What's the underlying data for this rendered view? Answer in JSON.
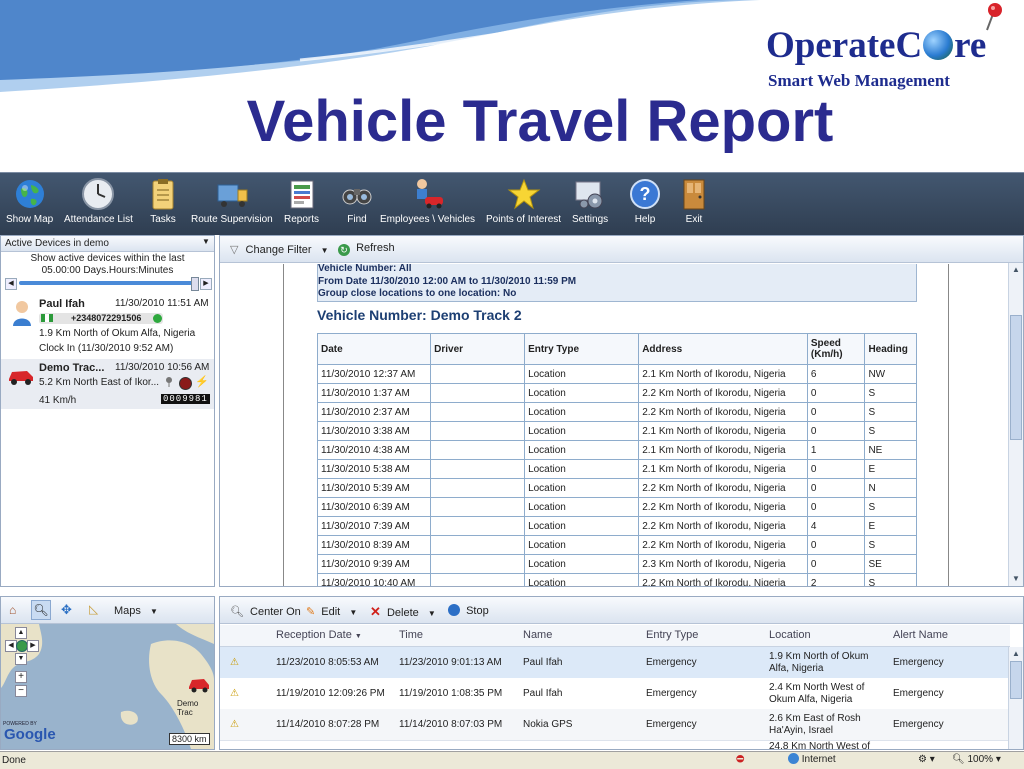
{
  "slide": {
    "title": "Vehicle Travel Report",
    "logo_left": "OperateC",
    "logo_right": "re",
    "logo_tagline": "Smart Web Management"
  },
  "toolbar": [
    {
      "label": "Show Map",
      "icon": "globe-icon"
    },
    {
      "label": "Attendance List",
      "icon": "clock-icon"
    },
    {
      "label": "Tasks",
      "icon": "clipboard-icon"
    },
    {
      "label": "Route Supervision",
      "icon": "truck-icon"
    },
    {
      "label": "Reports",
      "icon": "report-icon"
    },
    {
      "label": "Find",
      "icon": "binoculars-icon"
    },
    {
      "label": "Employees \\ Vehicles",
      "icon": "person-car-icon"
    },
    {
      "label": "Points of Interest",
      "icon": "star-icon"
    },
    {
      "label": "Settings",
      "icon": "gears-icon"
    },
    {
      "label": "Help",
      "icon": "help-icon"
    },
    {
      "label": "Exit",
      "icon": "door-icon"
    }
  ],
  "left_panel": {
    "filter_select": "Active Devices in demo",
    "filter_text_1": "Show active devices within the last",
    "filter_text_2": "05.00:00 Days.Hours:Minutes",
    "devices": [
      {
        "name": "Paul Ifah",
        "time": "11/30/2010 11:51 AM",
        "phone": "+2348072291506",
        "location": "1.9 Km North of Okum Alfa, Nigeria",
        "status": "Clock In (11/30/2010 9:52 AM)"
      },
      {
        "name": "Demo Trac...",
        "time": "11/30/2010 10:56 AM",
        "location": "5.2 Km North East of Ikor...",
        "speed": "41 Km/h",
        "odometer": "0009981"
      }
    ]
  },
  "main_toolbar": {
    "change_filter": "Change Filter",
    "refresh": "Refresh"
  },
  "report": {
    "header_line_1": "Vehicle Number: All",
    "header_line_2": "From Date 11/30/2010 12:00 AM to 11/30/2010 11:59 PM",
    "header_line_3": "Group close locations to one location: No",
    "section_title": "Vehicle Number: Demo Track 2",
    "columns": [
      "Date",
      "Driver",
      "Entry Type",
      "Address",
      "Speed (Km/h)",
      "Heading"
    ],
    "rows": [
      [
        "11/30/2010 12:37 AM",
        "",
        "Location",
        "2.1 Km North of Ikorodu, Nigeria",
        "6",
        "NW"
      ],
      [
        "11/30/2010 1:37 AM",
        "",
        "Location",
        "2.2 Km North of Ikorodu, Nigeria",
        "0",
        "S"
      ],
      [
        "11/30/2010 2:37 AM",
        "",
        "Location",
        "2.2 Km North of Ikorodu, Nigeria",
        "0",
        "S"
      ],
      [
        "11/30/2010 3:38 AM",
        "",
        "Location",
        "2.1 Km North of Ikorodu, Nigeria",
        "0",
        "S"
      ],
      [
        "11/30/2010 4:38 AM",
        "",
        "Location",
        "2.1 Km North of Ikorodu, Nigeria",
        "1",
        "NE"
      ],
      [
        "11/30/2010 5:38 AM",
        "",
        "Location",
        "2.1 Km North of Ikorodu, Nigeria",
        "0",
        "E"
      ],
      [
        "11/30/2010 5:39 AM",
        "",
        "Location",
        "2.2 Km North of Ikorodu, Nigeria",
        "0",
        "N"
      ],
      [
        "11/30/2010 6:39 AM",
        "",
        "Location",
        "2.2 Km North of Ikorodu, Nigeria",
        "0",
        "S"
      ],
      [
        "11/30/2010 7:39 AM",
        "",
        "Location",
        "2.2 Km North of Ikorodu, Nigeria",
        "4",
        "E"
      ],
      [
        "11/30/2010 8:39 AM",
        "",
        "Location",
        "2.2 Km North of Ikorodu, Nigeria",
        "0",
        "S"
      ],
      [
        "11/30/2010 9:39 AM",
        "",
        "Location",
        "2.3 Km North of Ikorodu, Nigeria",
        "0",
        "SE"
      ],
      [
        "11/30/2010 10:40 AM",
        "",
        "Location",
        "2.2 Km North of Ikorodu, Nigeria",
        "2",
        "S"
      ]
    ]
  },
  "map_panel": {
    "maps_label": "Maps",
    "marker_label": "Demo Trac",
    "scale": "8300 km",
    "powered_by": "POWERED BY",
    "google": "Google"
  },
  "alert_toolbar": {
    "center_on": "Center On",
    "edit": "Edit",
    "delete": "Delete",
    "stop": "Stop"
  },
  "alerts": {
    "columns": [
      "Reception Date",
      "Time",
      "Name",
      "Entry Type",
      "Location",
      "Alert Name"
    ],
    "rows": [
      [
        "11/23/2010 8:05:53 AM",
        "11/23/2010 9:01:13 AM",
        "Paul Ifah",
        "Emergency",
        "1.9 Km North of Okum Alfa, Nigeria",
        "Emergency"
      ],
      [
        "11/19/2010 12:09:26 PM",
        "11/19/2010 1:08:35 PM",
        "Paul Ifah",
        "Emergency",
        "2.4 Km North West of Okum Alfa, Nigeria",
        "Emergency"
      ],
      [
        "11/14/2010 8:07:28 PM",
        "11/14/2010 8:07:03 PM",
        "Nokia GPS",
        "Emergency",
        "2.6 Km East of Rosh Ha'Ayin, Israel",
        "Emergency"
      ]
    ],
    "partial_row_location": "24.8 Km North West of"
  },
  "statusbar": {
    "left": "Done",
    "zone": "Internet",
    "zoom": "100%"
  },
  "colors": {
    "title": "#2b2b8f",
    "toolbar": "#3a4b62",
    "selected_row": "#dce9f8"
  }
}
